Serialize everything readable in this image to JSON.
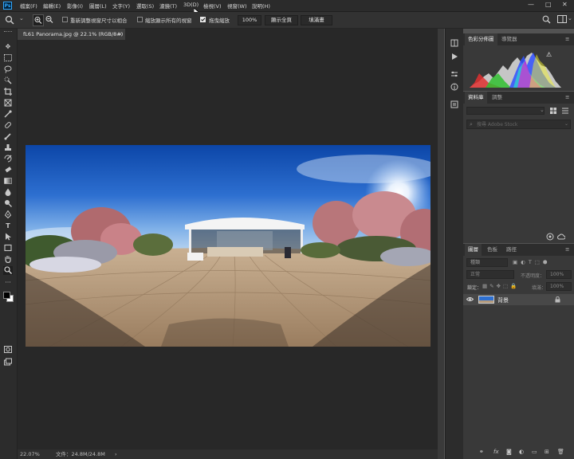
{
  "menu": {
    "logo": "Ps",
    "items": [
      "檔案(F)",
      "編輯(E)",
      "影像(I)",
      "圖層(L)",
      "文字(Y)",
      "選取(S)",
      "濾鏡(T)",
      "3D(D)",
      "檢視(V)",
      "視窗(W)",
      "說明(H)"
    ],
    "window_controls": [
      "—",
      "□",
      "✕"
    ]
  },
  "options": {
    "zoom_percent": "100%",
    "resize_windows_label": "重新調整視窗尺寸以相合",
    "zoom_all_windows_label": "縮放顯示所有的視窗",
    "scrubby_zoom_label": "拖曳縮放",
    "fit_screen_label": "顯示全頁",
    "fill_screen_label": "填滿畫",
    "resize_windows_checked": false,
    "zoom_all_windows_checked": false,
    "scrubby_zoom_checked": true
  },
  "document": {
    "tab_title": "fL61 Panorama.jpg @ 22.1% (RGB/8#)",
    "tab_close": "×",
    "zoom_status": "22.07%",
    "doc_status": "文件：24.8M/24.8M",
    "status_arrow": "›"
  },
  "histogram_panel": {
    "tabs": [
      "色彩分佈圖",
      "導覽器"
    ],
    "warning": "⚠"
  },
  "library_panel": {
    "tabs": [
      "資料庫",
      "調整"
    ],
    "search_placeholder": "搜尋 Adobe Stock"
  },
  "layers_panel": {
    "tabs": [
      "圖層",
      "色板",
      "路徑"
    ],
    "filter_label": "種類",
    "blend_mode": "正常",
    "opacity_label": "不透明度：",
    "opacity_value": "100%",
    "lock_label": "鎖定：",
    "fill_label": "填滿：",
    "fill_value": "100%",
    "layers": [
      {
        "name": "背景",
        "visible": true,
        "locked": true
      }
    ]
  },
  "colors": {
    "accent": "#31a8ff",
    "chrome_dark": "#2b2b2b",
    "panel": "#393939",
    "workspace": "#282828"
  }
}
